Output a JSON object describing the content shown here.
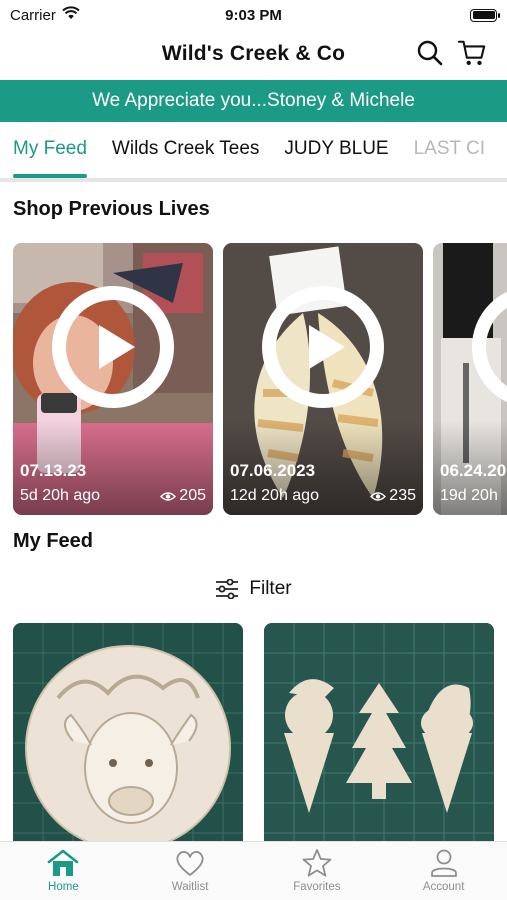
{
  "status_bar": {
    "carrier": "Carrier",
    "time": "9:03 PM",
    "battery_level": 1.0
  },
  "header": {
    "title": "Wild's Creek & Co",
    "icons": [
      "search-icon",
      "cart-icon"
    ]
  },
  "banner": {
    "text": "We Appreciate you...Stoney & Michele"
  },
  "tabs": [
    {
      "label": "My Feed",
      "active": true
    },
    {
      "label": "Wilds Creek Tees",
      "active": false
    },
    {
      "label": "JUDY BLUE",
      "active": false
    },
    {
      "label": "LAST CI",
      "active": false
    }
  ],
  "shop_previous_lives": {
    "title": "Shop Previous Lives",
    "items": [
      {
        "date": "07.13.23",
        "ago": "5d 20h ago",
        "views": "205"
      },
      {
        "date": "07.06.2023",
        "ago": "12d 20h ago",
        "views": "235"
      },
      {
        "date": "06.24.20",
        "ago": "19d 20h",
        "views": ""
      }
    ]
  },
  "my_feed": {
    "title": "My Feed",
    "filter_label": "Filter"
  },
  "bottom_nav": [
    {
      "label": "Home",
      "icon": "home-icon",
      "active": true
    },
    {
      "label": "Waitlist",
      "icon": "heart-icon",
      "active": false
    },
    {
      "label": "Favorites",
      "icon": "star-icon",
      "active": false
    },
    {
      "label": "Account",
      "icon": "person-icon",
      "active": false
    }
  ],
  "colors": {
    "accent": "#1b9a85",
    "tab_divider": "#e5e5e5",
    "inactive_nav": "#8e8e8e"
  }
}
